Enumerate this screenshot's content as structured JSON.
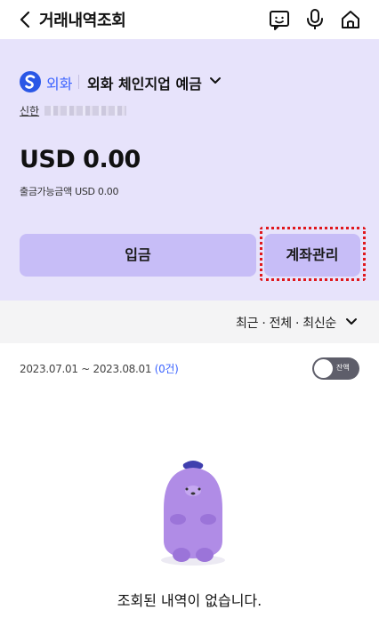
{
  "header": {
    "title": "거래내역조회",
    "icons": [
      "chevron-left-icon",
      "chat-bot-icon",
      "microphone-icon",
      "home-icon"
    ]
  },
  "account": {
    "type": "외화",
    "name": "외화 체인지업 예금",
    "bank_short": "신한",
    "balance": "USD 0.00",
    "available": "출금가능금액 USD 0.00",
    "deposit_label": "입금",
    "manage_label": "계좌관리"
  },
  "filter": {
    "label": "최근 · 전체 · 최신순"
  },
  "period": {
    "range": "2023.07.01 ~ 2023.08.01",
    "count": "(0건)"
  },
  "toggle": {
    "label": "잔액"
  },
  "empty": {
    "message": "조회된 내역이 없습니다."
  },
  "colors": {
    "card_bg": "#e7e3fb",
    "button_bg": "#c7bdf7",
    "accent_blue": "#3c64ff",
    "highlight_red": "#e0181d"
  }
}
